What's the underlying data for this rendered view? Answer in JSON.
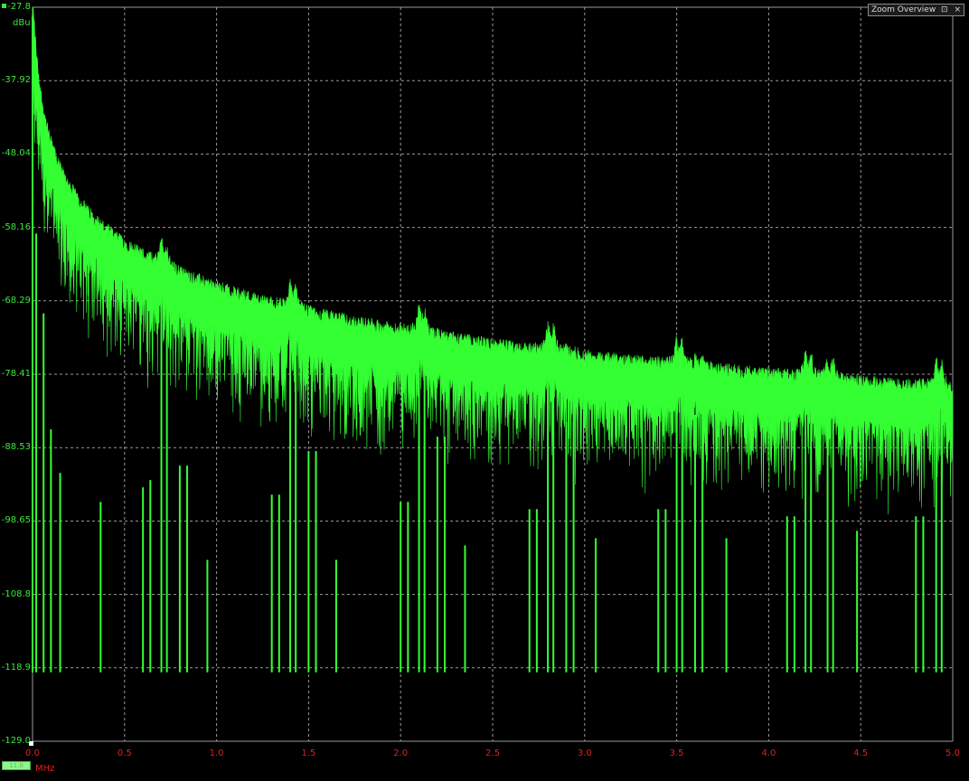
{
  "chart_data": {
    "type": "line",
    "title": "",
    "xlabel": "MHz",
    "ylabel": "dBu",
    "xlim": [
      0.0,
      5.0
    ],
    "ylim": [
      -129.0,
      -27.8
    ],
    "x_ticks": [
      "0.0",
      "0.5",
      "1.0",
      "1.5",
      "2.0",
      "2.5",
      "3.0",
      "3.5",
      "4.0",
      "4.5",
      "5.0"
    ],
    "y_ticks": [
      "-27.8",
      "-37.92",
      "-48.04",
      "-58.16",
      "-68.29",
      "-78.41",
      "-88.53",
      "-98.65",
      "-108.8",
      "-118.9",
      "-129.0"
    ],
    "grid": true,
    "background": "#000000",
    "series_color": "#33ff33",
    "noise_floor_dbu": -119.5,
    "series": [
      {
        "peaks": [
          {
            "x": 0.0,
            "y": -29
          },
          {
            "x": 0.02,
            "y": -59
          },
          {
            "x": 0.06,
            "y": -70
          },
          {
            "x": 0.1,
            "y": -86
          },
          {
            "x": 0.15,
            "y": -92
          },
          {
            "x": 0.37,
            "y": -96
          },
          {
            "x": 0.6,
            "y": -94
          },
          {
            "x": 0.64,
            "y": -93
          },
          {
            "x": 0.7,
            "y": -64
          },
          {
            "x": 0.73,
            "y": -66
          },
          {
            "x": 0.8,
            "y": -91
          },
          {
            "x": 0.84,
            "y": -91
          },
          {
            "x": 0.95,
            "y": -104
          },
          {
            "x": 1.3,
            "y": -95
          },
          {
            "x": 1.34,
            "y": -95
          },
          {
            "x": 1.4,
            "y": -70
          },
          {
            "x": 1.43,
            "y": -71
          },
          {
            "x": 1.5,
            "y": -89
          },
          {
            "x": 1.54,
            "y": -89
          },
          {
            "x": 1.65,
            "y": -104
          },
          {
            "x": 2.0,
            "y": -96
          },
          {
            "x": 2.04,
            "y": -96
          },
          {
            "x": 2.1,
            "y": -73
          },
          {
            "x": 2.13,
            "y": -74
          },
          {
            "x": 2.2,
            "y": -87
          },
          {
            "x": 2.24,
            "y": -87
          },
          {
            "x": 2.35,
            "y": -102
          },
          {
            "x": 2.7,
            "y": -97
          },
          {
            "x": 2.74,
            "y": -97
          },
          {
            "x": 2.8,
            "y": -76
          },
          {
            "x": 2.83,
            "y": -76
          },
          {
            "x": 2.9,
            "y": -85
          },
          {
            "x": 2.94,
            "y": -85
          },
          {
            "x": 3.06,
            "y": -101
          },
          {
            "x": 3.4,
            "y": -97
          },
          {
            "x": 3.44,
            "y": -97
          },
          {
            "x": 3.5,
            "y": -78
          },
          {
            "x": 3.53,
            "y": -78
          },
          {
            "x": 3.6,
            "y": -84
          },
          {
            "x": 3.64,
            "y": -84
          },
          {
            "x": 3.77,
            "y": -101
          },
          {
            "x": 4.1,
            "y": -98
          },
          {
            "x": 4.14,
            "y": -98
          },
          {
            "x": 4.2,
            "y": -80
          },
          {
            "x": 4.23,
            "y": -80
          },
          {
            "x": 4.32,
            "y": -82
          },
          {
            "x": 4.35,
            "y": -82
          },
          {
            "x": 4.48,
            "y": -100
          },
          {
            "x": 4.8,
            "y": -98
          },
          {
            "x": 4.84,
            "y": -98
          },
          {
            "x": 4.91,
            "y": -81
          },
          {
            "x": 4.94,
            "y": -81
          }
        ]
      }
    ]
  },
  "axis": {
    "y_unit": "dBu",
    "x_unit": "MHz"
  },
  "zoom_overview": {
    "label": "Zoom Overview",
    "restore_icon": "restore-icon",
    "close_icon": "close-icon",
    "restore_glyph": "⊡",
    "close_glyph": "×"
  },
  "scroll_thumb": {
    "value": "11.0"
  }
}
